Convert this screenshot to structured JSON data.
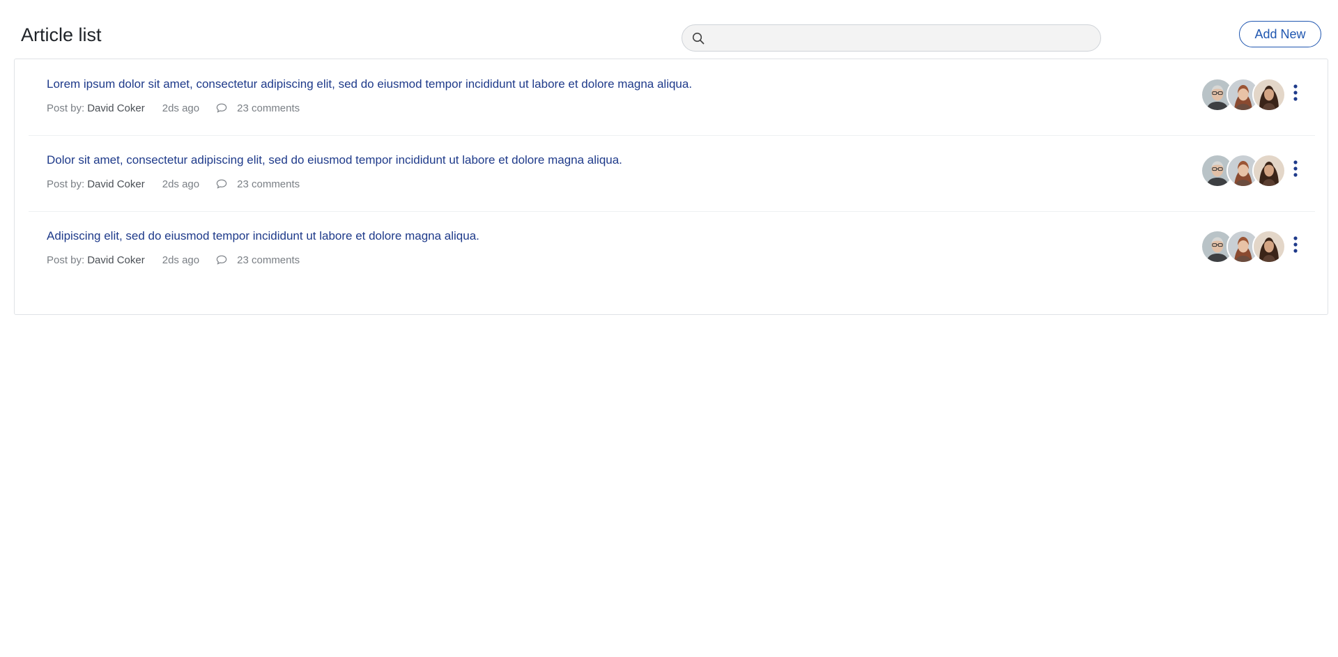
{
  "header": {
    "title": "Article list",
    "search_placeholder": "",
    "add_button_label": "Add New"
  },
  "articles": [
    {
      "title": "Lorem ipsum dolor sit amet, consectetur adipiscing elit, sed do eiusmod tempor incididunt ut labore et dolore magna aliqua.",
      "post_by_label": "Post by:",
      "author": "David Coker",
      "time": "2ds ago",
      "comments": "23 comments"
    },
    {
      "title": "Dolor sit amet, consectetur adipiscing elit, sed do eiusmod tempor incididunt ut labore et dolore magna aliqua.",
      "post_by_label": "Post by:",
      "author": "David Coker",
      "time": "2ds ago",
      "comments": "23 comments"
    },
    {
      "title": "Adipiscing elit, sed do eiusmod tempor incididunt ut labore et dolore magna aliqua.",
      "post_by_label": "Post by:",
      "author": "David Coker",
      "time": "2ds ago",
      "comments": "23 comments"
    }
  ],
  "icons": {
    "search": "search-icon",
    "comment": "comment-icon",
    "more": "more-vertical-icon"
  },
  "colors": {
    "title_link": "#1e3a8a",
    "accent": "#1f56b0",
    "meta_text": "#7a7f85"
  }
}
